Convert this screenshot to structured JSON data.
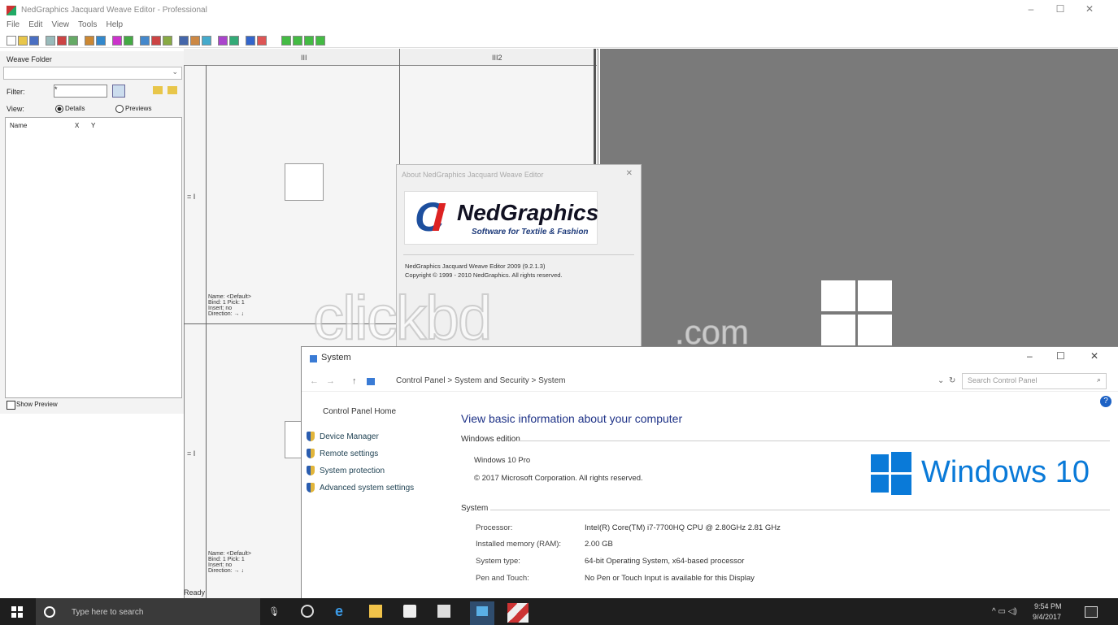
{
  "app": {
    "title": "NedGraphics Jacquard Weave Editor - Professional",
    "menu": [
      "File",
      "Edit",
      "View",
      "Tools",
      "Help"
    ],
    "window_buttons": [
      "–",
      "☐",
      "✕"
    ]
  },
  "left_panel": {
    "header": "Weave Folder",
    "filter_label": "Filter:",
    "filter_value": "*",
    "view_label": "View:",
    "opt_details": "Details",
    "opt_previews": "Previews",
    "col_name": "Name",
    "col_x": "X",
    "col_y": "Y",
    "show_preview": "Show Preview"
  },
  "grid": {
    "col1": "III",
    "col2": "III2",
    "row_marker": "= I",
    "info_lines": [
      "Name: <Default>",
      "Bind: 1 Pick: 1",
      "Insert: no",
      "Direction: → ↓"
    ],
    "status": "Ready"
  },
  "about": {
    "title": "About NedGraphics Jacquard Weave Editor",
    "close": "✕",
    "logo_letter": "C",
    "logo_text": "NedGraphics",
    "logo_sub": "Software for Textile & Fashion",
    "version": "NedGraphics Jacquard Weave Editor 2009 (9.2.1.3)",
    "copyright": "Copyright © 1999 - 2010 NedGraphics. All rights reserved."
  },
  "system": {
    "title": "System",
    "breadcrumb": [
      "Control Panel",
      "System and Security",
      "System"
    ],
    "search_placeholder": "Search Control Panel",
    "sidebar": [
      "Control Panel Home",
      "Device Manager",
      "Remote settings",
      "System protection",
      "Advanced system settings"
    ],
    "heading": "View basic information about your computer",
    "windows_edition_label": "Windows edition",
    "edition": "Windows 10 Pro",
    "copyright": "© 2017 Microsoft Corporation. All rights reserved.",
    "logo_text": "Windows 10",
    "system_label": "System",
    "rows": [
      {
        "k": "Processor:",
        "v": "Intel(R) Core(TM) i7-7700HQ CPU @ 2.80GHz   2.81 GHz"
      },
      {
        "k": "Installed memory (RAM):",
        "v": "2.00 GB"
      },
      {
        "k": "System type:",
        "v": "64-bit Operating System, x64-based processor"
      },
      {
        "k": "Pen and Touch:",
        "v": "No Pen or Touch Input is available for this Display"
      }
    ]
  },
  "taskbar": {
    "search_placeholder": "Type here to search",
    "time": "9:54 PM",
    "date": "9/4/2017"
  },
  "watermark": {
    "main": "clickbd",
    "suffix": ".com"
  }
}
